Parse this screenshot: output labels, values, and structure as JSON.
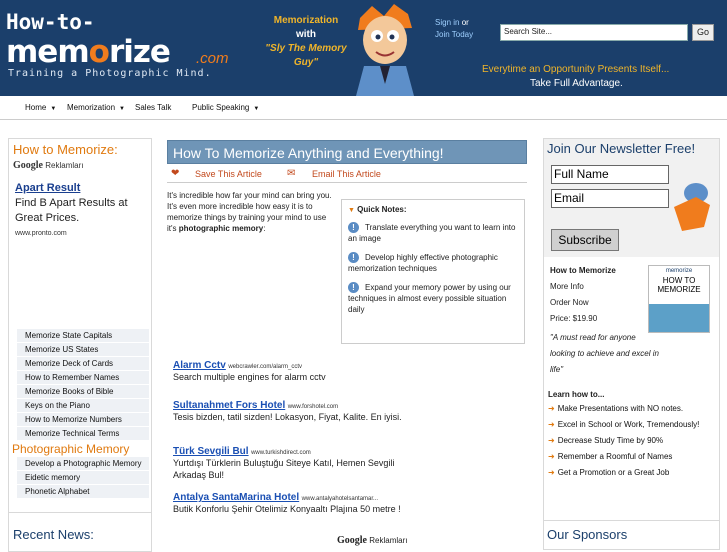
{
  "header": {
    "logo_line1": "How-to-",
    "logo_line2_a": "mem",
    "logo_line2_b": "o",
    "logo_line2_c": "rize",
    "logo_com": ".com",
    "logo_tagline": "Training a Photographic Mind.",
    "promo_line1": "Memorization",
    "promo_line2": "with",
    "promo_line3": "\"Sly The Memory Guy\"",
    "signin_link": "Sign in",
    "signin_or": " or",
    "join_link": "Join Today",
    "search_placeholder": "Search Site...",
    "go_button": "Go",
    "slogan_1": "Everytime an Opportunity Presents Itself...",
    "slogan_2": "Take Full Advantage."
  },
  "nav": [
    {
      "label": "Home"
    },
    {
      "label": "Memorization"
    },
    {
      "label": "Sales Talk"
    },
    {
      "label": "Public Speaking"
    }
  ],
  "left": {
    "heading": "How to Memorize:",
    "google_brand": "Google",
    "google_ads": "Reklamları",
    "ad_title": "Apart Result",
    "ad_desc": "Find B Apart Results at Great Prices.",
    "ad_url": "www.pronto.com",
    "links": [
      "Memorize State Capitals",
      "Memorize US States",
      "Memorize Deck of Cards",
      "How to Remember Names",
      "Memorize Books of Bible",
      "Keys on the Piano",
      "How to Memorize Numbers",
      "Memorize Technical Terms"
    ],
    "photo_heading": "Photographic Memory",
    "photo_links": [
      "Develop a Photographic Memory",
      "Eidetic memory",
      "Phonetic Alphabet"
    ],
    "recent_heading": "Recent News:"
  },
  "article": {
    "title": "How To Memorize Anything and Everything!",
    "save_label": "Save This Article",
    "email_label": "Email This Article",
    "intro_a": "It's incredible how far your mind can bring you. It's even more incredible how easy it is to memorize things by training your mind to use it's ",
    "intro_b": "photographic memory",
    "intro_c": ":",
    "notes_heading": "Quick Notes:",
    "notes": [
      "Translate everything you want to learn into an image",
      "Develop highly effective photographic memorization techniques",
      "Expand your memory power by using our techniques in almost every possible situation daily"
    ]
  },
  "ads": [
    {
      "title": "Alarm Cctv",
      "url": "webcrawler.com/alarm_cctv",
      "desc": "Search multiple engines for alarm cctv"
    },
    {
      "title": "Sultanahmet Fors Hotel",
      "url": "www.forshotel.com",
      "desc": "Tesis bizden, tatil sizden! Lokasyon, Fiyat, Kalite. En iyisi."
    },
    {
      "title": "Türk Sevgili Bul",
      "url": "www.turkishdirect.com",
      "desc": "Yurtdışı Türklerin Buluştuğu Siteye Katıl, Hemen Sevgili Arkadaş Bul!"
    },
    {
      "title": "Antalya SantaMarina Hotel",
      "url": "www.antalyahotelsantamar...",
      "desc": "Butik Konforlu Şehir Otelimiz Konyaaltı Plajına 50 metre !"
    }
  ],
  "center_google": {
    "brand": "Google",
    "label": "Reklamları"
  },
  "right": {
    "newsletter_heading": "Join Our Newsletter Free!",
    "full_name": "Full Name",
    "email": "Email",
    "subscribe": "Subscribe",
    "book_title": "How to Memorize",
    "book_more": "More Info",
    "book_order": "Order Now",
    "book_price": "Price: $19.90",
    "book_quote": "\"A must read for anyone looking to achieve and excel in life\"",
    "cover_brand": "memorize",
    "cover_title": "HOW TO MEMORIZE",
    "learn_heading": "Learn how to...",
    "learn_items": [
      "Make Presentations with NO notes.",
      "Excel in School or Work, Tremendously!",
      "Decrease Study Time by 90%",
      "Remember a Roomful of Names",
      "Get a Promotion or a Great Job"
    ],
    "sponsors_heading": "Our Sponsors"
  },
  "colors": {
    "header_bg": "#1b3f6b",
    "accent_orange": "#e07a10",
    "title_bar": "#6f95b7"
  }
}
